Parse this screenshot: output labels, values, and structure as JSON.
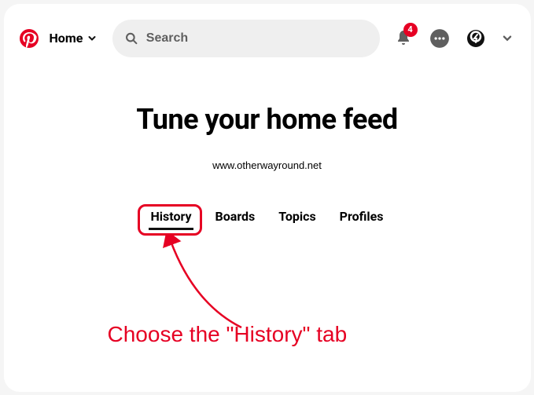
{
  "header": {
    "home_label": "Home",
    "search_placeholder": "Search",
    "notification_count": "4"
  },
  "page": {
    "title": "Tune your home feed",
    "watermark": "www.otherwayround.net"
  },
  "tabs": {
    "items": [
      "History",
      "Boards",
      "Topics",
      "Profiles"
    ],
    "active_index": 0
  },
  "annotation": {
    "text": "Choose the \"History\" tab"
  }
}
